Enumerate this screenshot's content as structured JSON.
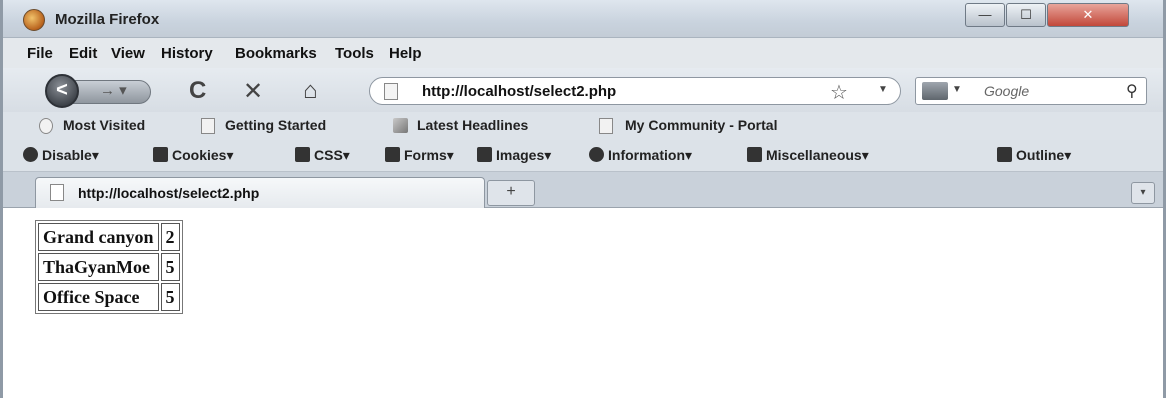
{
  "window": {
    "title": "Mozilla Firefox",
    "close_glyph": "✕",
    "minimize_glyph": "—",
    "maximize_glyph": "☐"
  },
  "menu": [
    "File",
    "Edit",
    "View",
    "History",
    "Bookmarks",
    "Tools",
    "Help"
  ],
  "navigation": {
    "back_glyph": "<",
    "reload_glyph": "C",
    "stop_glyph": "✕",
    "home_glyph": "⌂",
    "url": "http://localhost/select2.php",
    "search_placeholder": "Google"
  },
  "bookmarks": [
    "Most Visited",
    "Getting Started",
    "Latest Headlines",
    "My Community - Portal"
  ],
  "dev_toolbar": [
    "Disable",
    "Cookies",
    "CSS",
    "Forms",
    "Images",
    "Information",
    "Miscellaneous",
    "Outline"
  ],
  "tab": {
    "title": "http://localhost/select2.php",
    "new_tab_glyph": "+"
  },
  "table": {
    "rows": [
      [
        "Grand canyon",
        "2"
      ],
      [
        "ThaGyanMoe",
        "5"
      ],
      [
        "Office Space",
        "5"
      ]
    ]
  }
}
